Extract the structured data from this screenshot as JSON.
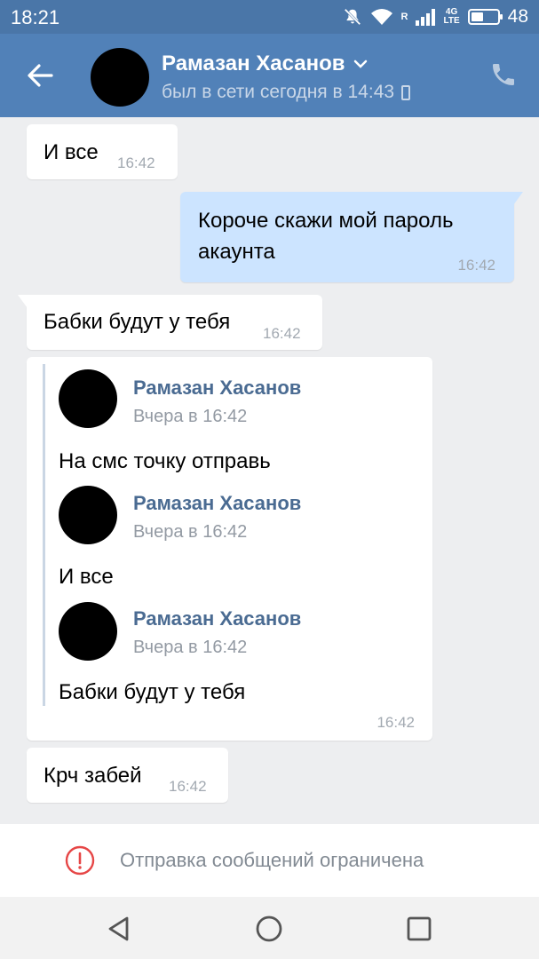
{
  "status_bar": {
    "time": "18:21",
    "network_r": "R",
    "network_type_top": "4G",
    "network_type_bottom": "LTE",
    "battery_level": "48",
    "battery_fraction": 0.48
  },
  "header": {
    "contact_name": "Рамазан Хасанов",
    "last_seen": "был в сети сегодня в 14:43"
  },
  "messages": [
    {
      "direction": "in",
      "text": "И все",
      "time": "16:42"
    },
    {
      "direction": "out",
      "text_line1": "Короче скажи мой пароль",
      "text_line2": "акаунта",
      "time": "16:42"
    },
    {
      "direction": "in",
      "text": "Бабки будут у тебя",
      "time": "16:42"
    },
    {
      "direction": "in",
      "time": "16:42",
      "forwarded": [
        {
          "author": "Рамазан Хасанов",
          "date": "Вчера в 16:42",
          "text": "На смс точку отправь"
        },
        {
          "author": "Рамазан Хасанов",
          "date": "Вчера в 16:42",
          "text": "И все"
        },
        {
          "author": "Рамазан Хасанов",
          "date": "Вчера в 16:42",
          "text": "Бабки будут у тебя"
        }
      ]
    },
    {
      "direction": "in",
      "text": "Крч забей",
      "time": "16:42"
    }
  ],
  "footer": {
    "restriction_text": "Отправка сообщений ограничена"
  },
  "colors": {
    "status_bar": "#4a76a8",
    "app_bar": "#5181b8",
    "chat_background": "#edeef0",
    "outgoing_bubble": "#cce4ff",
    "incoming_bubble": "#ffffff",
    "forward_author": "#4a6b92",
    "warning": "#e64646"
  }
}
